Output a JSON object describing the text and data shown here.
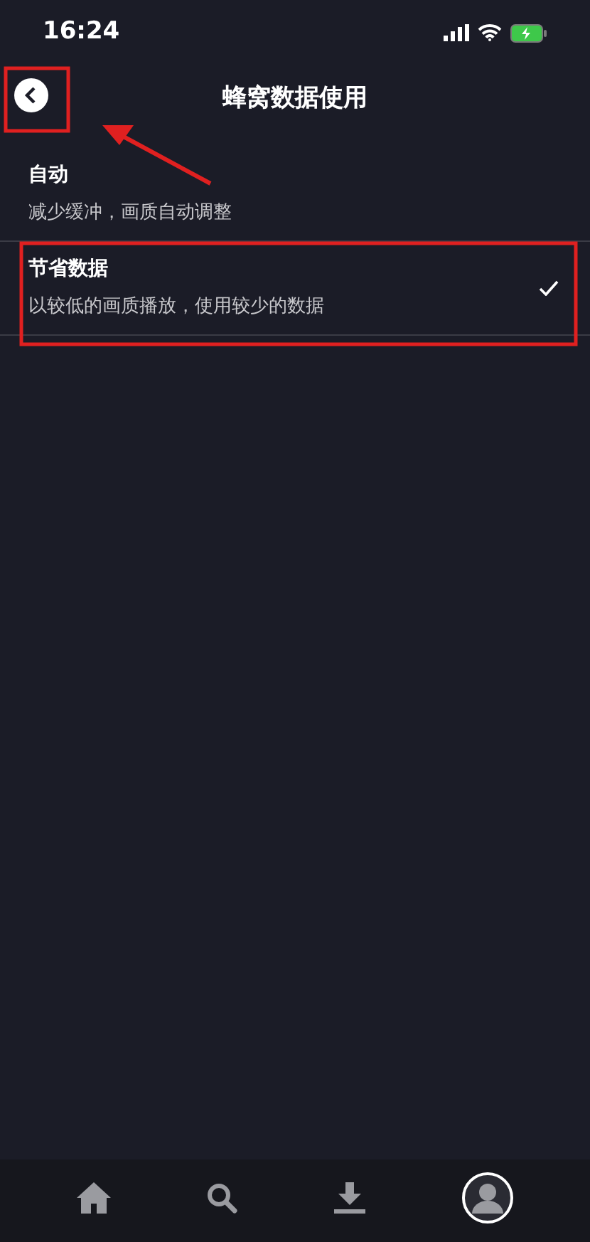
{
  "status_bar": {
    "time": "16:24"
  },
  "header": {
    "title": "蜂窝数据使用"
  },
  "options": [
    {
      "label": "自动",
      "description": "减少缓冲，画质自动调整",
      "selected": false
    },
    {
      "label": "节省数据",
      "description": "以较低的画质播放，使用较少的数据",
      "selected": true
    }
  ],
  "tab_bar": [
    {
      "kind": "home"
    },
    {
      "kind": "search"
    },
    {
      "kind": "download"
    },
    {
      "kind": "avatar"
    }
  ]
}
